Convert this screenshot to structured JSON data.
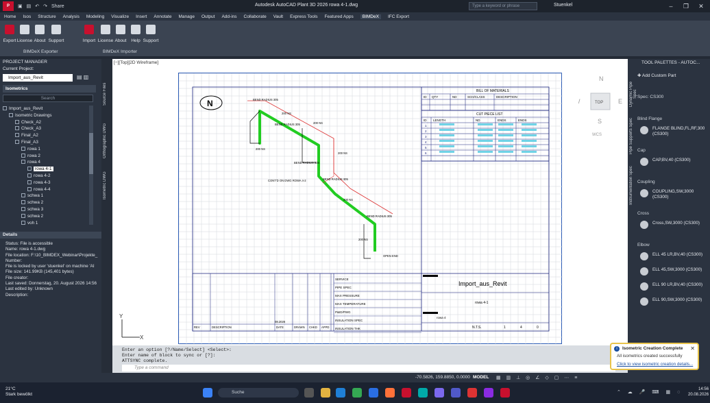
{
  "app": {
    "window_title": "Autodesk AutoCAD Plant 3D 2026  rowa 4-1.dwg",
    "share_label": "Share",
    "search_placeholder": "Type a keyword or phrase",
    "user": "Stuenkel"
  },
  "menubar": {
    "items": [
      "Home",
      "Isos",
      "Structure",
      "Analysis",
      "Modeling",
      "Visualize",
      "Insert",
      "Annotate",
      "Manage",
      "Output",
      "Add-ins",
      "Collaborate",
      "Vault",
      "Express Tools",
      "Featured Apps",
      "BIMDeX",
      "IFC Export"
    ],
    "active": "BIMDeX"
  },
  "ribbon": {
    "exporter": {
      "buttons": [
        "Export",
        "License",
        "About",
        "Support"
      ],
      "group_label": "BIMDeX Exporter"
    },
    "importer": {
      "buttons": [
        "Import",
        "License",
        "About",
        "Help",
        "Support"
      ],
      "group_label": "BIMDeX Importer"
    }
  },
  "project_manager": {
    "title": "PROJECT MANAGER",
    "current_project_label": "Current Project:",
    "current_project": "Import_aus_Revit",
    "section": "Isometrics",
    "search_placeholder": "Search",
    "tree": [
      {
        "label": "Import_aus_Revit",
        "level": 0
      },
      {
        "label": "Isometric Drawings",
        "level": 1
      },
      {
        "label": "Check_A2",
        "level": 2
      },
      {
        "label": "Check_A3",
        "level": 2
      },
      {
        "label": "Final_A2",
        "level": 2
      },
      {
        "label": "Final_A3",
        "level": 2
      },
      {
        "label": "rowa 1",
        "level": 3
      },
      {
        "label": "rowa 2",
        "level": 3
      },
      {
        "label": "rowa 4",
        "level": 3
      },
      {
        "label": "rowa 4-1",
        "level": 4,
        "selected": true
      },
      {
        "label": "rowa 4-2",
        "level": 4
      },
      {
        "label": "rowa 4-3",
        "level": 4
      },
      {
        "label": "rowa 4-4",
        "level": 4
      },
      {
        "label": "schwa 1",
        "level": 3
      },
      {
        "label": "schwa 2",
        "level": 3
      },
      {
        "label": "schwa 3",
        "level": 3
      },
      {
        "label": "schwa 2",
        "level": 3
      },
      {
        "label": "voh 1",
        "level": 3
      }
    ]
  },
  "details": {
    "title": "Details",
    "lines": [
      "Status: File is accessible",
      "Name: rowa 4-1.dwg",
      "File location: F:\\10_BIMDEX_Webinar\\Projekte_",
      "Number:",
      "File is locked by user 'stuenkel' on machine 'AI",
      "File size: 141.99KB (145,401 bytes)",
      "File creator:",
      "Last saved: Donnerstag, 20. August 2026 14:56",
      "Last edited by: Unknown",
      "Description:"
    ]
  },
  "vertical_tabs": [
    "Source Files",
    "Orthographic DWG",
    "Isometric DWG"
  ],
  "viewport": {
    "label": "[−][Top][2D Wireframe]",
    "viewcube": {
      "top": "TOP",
      "n": "N",
      "w": "W",
      "e": "E",
      "s": "S",
      "wcs": "WCS"
    },
    "drawing": {
      "bom_title": "BILL OF MATERIALS",
      "bom_headers": [
        "ID",
        "QTY",
        "ND",
        "SCH/CLASS",
        "DESCRIPTION"
      ],
      "cut_title": "CUT PIECE LIST",
      "cut_headers": [
        "ID",
        "LENGTH",
        "ND",
        "ENDS",
        "ENDS"
      ],
      "cut_ids": [
        "1",
        "2",
        "3",
        "4",
        "5",
        "6"
      ],
      "title_text": "Import_aus_Revit",
      "drawing_name": "rowa 4-1",
      "sub_name": "rowa 4",
      "scale": "N.T.S.",
      "sheet": [
        "1",
        "4",
        "0"
      ],
      "revision_labels": [
        "REV",
        "DESCRIPTION",
        "DATE",
        "DRAWN",
        "CHKD",
        "APPD"
      ],
      "service_labels": [
        "SERVICE",
        "PIPE SPEC",
        "MAX PRESSURE",
        "MAX TEMPERATURE",
        "P&ID/PWG",
        "INSULATION SPEC",
        "INSULATION THK"
      ],
      "date": "08.2026",
      "iso_labels": [
        "BEND RADIUS 305",
        "BEND RADIUS 305",
        "BEND RADIUS 305",
        "BEND RADIUS 305",
        "BEND RADIUS 305",
        "CONT'D ON DWG ROWA 4-2",
        "OPEN END",
        "200 NS",
        "200 NS",
        "200 NS",
        "200 NS",
        "200 NS",
        "200 NS"
      ]
    }
  },
  "command": {
    "lines": [
      "Enter an option [?/Name/Select] <Select>:",
      "Enter name of block to sync or [?]:",
      "ATTSYNC complete."
    ],
    "placeholder": "Type a command"
  },
  "status": {
    "coords": "-70.5826, 159.8850, 0.0000",
    "model": "MODEL"
  },
  "tool_palette": {
    "title": "TOOL PALETTES - AUTOC...",
    "add_custom": "Add Custom Part",
    "spec": "Spec: CS300",
    "sections": [
      {
        "name": "Blind Flange",
        "items": [
          "FLANGE BLIND,FL,RF,300 (CS300)"
        ]
      },
      {
        "name": "Cap",
        "items": [
          "CAP,BV,40 (CS300)"
        ]
      },
      {
        "name": "Coupling",
        "items": [
          "COUPLING,SW,3000 (CS300)"
        ]
      },
      {
        "name": "Cross",
        "items": [
          "Cross,SW,3000 (CS300)"
        ]
      },
      {
        "name": "Elbow",
        "items": [
          "ELL 45 LR,BV,40 (CS300)",
          "ELL 45,SW,3000 (CS300)",
          "ELL 90 LR,BV,40 (CS300)",
          "ELL 90,SW,3000 (CS300)"
        ]
      }
    ],
    "side_tabs": [
      "Dynamic Pipe Spec",
      "Pipe Supports Spec",
      "Instrumentation Spec"
    ]
  },
  "notification": {
    "title": "Isometric Creation Complete",
    "body": "All isometrics created successfully",
    "link": "Click to view isometric creation details..."
  },
  "taskbar": {
    "weather_temp": "21°C",
    "weather_text": "Stark bewölkt",
    "search": "Suche",
    "time": "14:56",
    "date": "20.08.2026"
  },
  "colors": {
    "accent": "#c8102e",
    "pipe": "#22cc22",
    "border": "#2b5bb5"
  }
}
